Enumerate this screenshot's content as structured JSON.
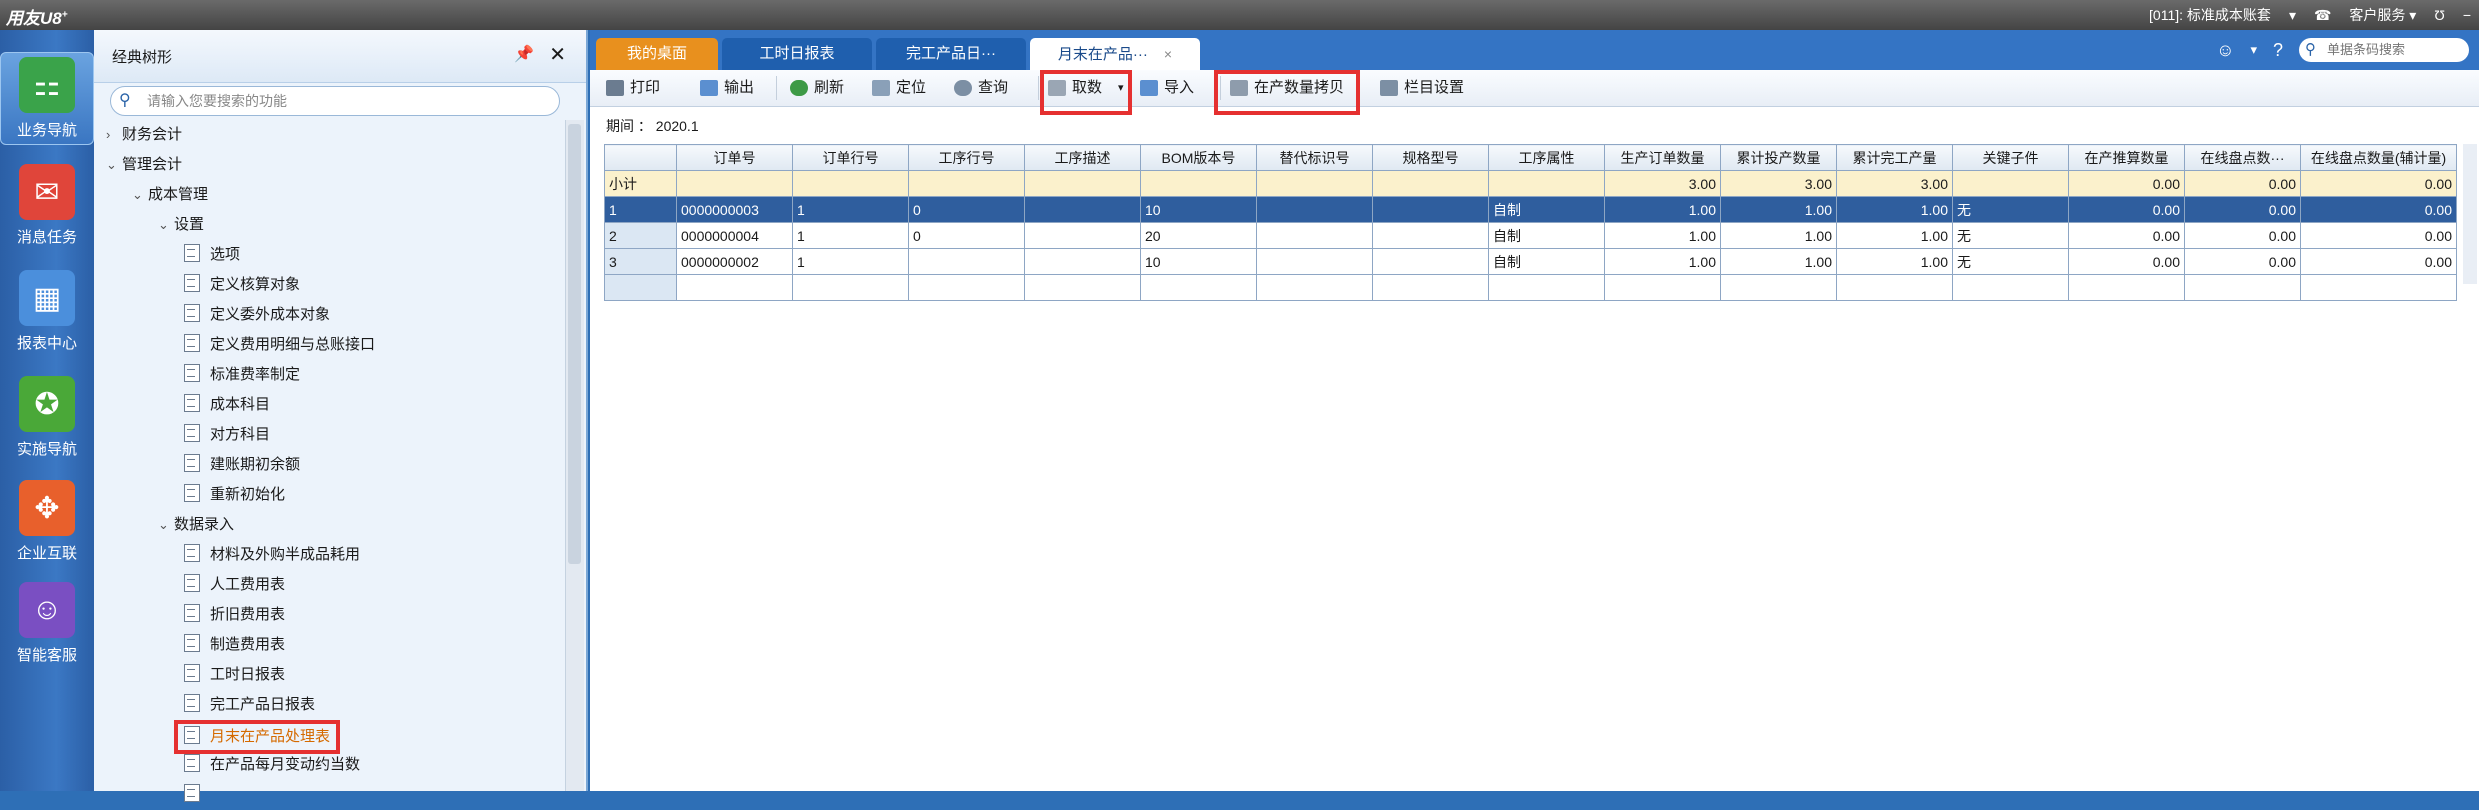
{
  "titlebar": {
    "logo": "用友U8",
    "logo_sup": "+",
    "account": "[011]: 标准成本账套",
    "customer_service": "客户服务",
    "icons": [
      "dropdown-icon",
      "headset-icon",
      "dropdown-icon",
      "u-icon",
      "minus-icon"
    ]
  },
  "leftnav": {
    "items": [
      {
        "label": "业务导航",
        "icon": "business-nav-icon",
        "color": "#3aa34a",
        "active": true
      },
      {
        "label": "消息任务",
        "icon": "message-task-icon",
        "color": "#e0453a"
      },
      {
        "label": "报表中心",
        "icon": "report-center-icon",
        "color": "#4b8fdc"
      },
      {
        "label": "实施导航",
        "icon": "compass-icon",
        "color": "#4aa838"
      },
      {
        "label": "企业互联",
        "icon": "enterprise-connect-icon",
        "color": "#e8602c"
      },
      {
        "label": "智能客服",
        "icon": "smart-service-icon",
        "color": "#7a4fc2"
      }
    ]
  },
  "tree": {
    "title": "经典树形",
    "search_placeholder": "请输入您要搜索的功能",
    "nodes": [
      {
        "label": "财务会计",
        "type": "collapsed"
      },
      {
        "label": "管理会计",
        "type": "expanded"
      },
      {
        "label": "成本管理",
        "type": "expanded"
      },
      {
        "label": "设置",
        "type": "expanded"
      },
      {
        "label": "选项",
        "type": "leaf"
      },
      {
        "label": "定义核算对象",
        "type": "leaf"
      },
      {
        "label": "定义委外成本对象",
        "type": "leaf"
      },
      {
        "label": "定义费用明细与总账接口",
        "type": "leaf"
      },
      {
        "label": "标准费率制定",
        "type": "leaf"
      },
      {
        "label": "成本科目",
        "type": "leaf"
      },
      {
        "label": "对方科目",
        "type": "leaf"
      },
      {
        "label": "建账期初余额",
        "type": "leaf"
      },
      {
        "label": "重新初始化",
        "type": "leaf"
      },
      {
        "label": "数据录入",
        "type": "expanded"
      },
      {
        "label": "材料及外购半成品耗用",
        "type": "leaf"
      },
      {
        "label": "人工费用表",
        "type": "leaf"
      },
      {
        "label": "折旧费用表",
        "type": "leaf"
      },
      {
        "label": "制造费用表",
        "type": "leaf"
      },
      {
        "label": "工时日报表",
        "type": "leaf"
      },
      {
        "label": "完工产品日报表",
        "type": "leaf"
      },
      {
        "label": "月末在产品处理表",
        "type": "leaf",
        "highlight": true
      },
      {
        "label": "在产品每月变动约当数",
        "type": "leaf"
      },
      {
        "label": "",
        "type": "leaf"
      }
    ]
  },
  "tabs": [
    {
      "label": "我的桌面",
      "kind": "home"
    },
    {
      "label": "工时日报表",
      "kind": "norm"
    },
    {
      "label": "完工产品日···",
      "kind": "norm"
    },
    {
      "label": "月末在产品···",
      "kind": "active",
      "close": "×"
    }
  ],
  "barsearch_placeholder": "单据条码搜索",
  "toolbar": {
    "print": "打印",
    "export": "输出",
    "refresh": "刷新",
    "locate": "定位",
    "query": "查询",
    "fetch": "取数",
    "import": "导入",
    "copy_wip_qty": "在产数量拷贝",
    "column_settings": "栏目设置"
  },
  "period_label": "期间 ： 2020.1",
  "grid": {
    "headers": [
      "",
      "订单号",
      "订单行号",
      "工序行号",
      "工序描述",
      "BOM版本号",
      "替代标识号",
      "规格型号",
      "工序属性",
      "生产订单数量",
      "累计投产数量",
      "累计完工产量",
      "关键子件",
      "在产推算数量",
      "在线盘点数···",
      "在线盘点数量(辅计量)"
    ],
    "subtotal": [
      "小计",
      "",
      "",
      "",
      "",
      "",
      "",
      "",
      "",
      "3.00",
      "3.00",
      "3.00",
      "",
      "0.00",
      "0.00",
      "0.00"
    ],
    "rows": [
      [
        "1",
        "0000000003",
        "1",
        "0",
        "",
        "10",
        "",
        "",
        "自制",
        "1.00",
        "1.00",
        "1.00",
        "无",
        "0.00",
        "0.00",
        "0.00"
      ],
      [
        "2",
        "0000000004",
        "1",
        "0",
        "",
        "20",
        "",
        "",
        "自制",
        "1.00",
        "1.00",
        "1.00",
        "无",
        "0.00",
        "0.00",
        "0.00"
      ],
      [
        "3",
        "0000000002",
        "1",
        "",
        "",
        "10",
        "",
        "",
        "自制",
        "1.00",
        "1.00",
        "1.00",
        "无",
        "0.00",
        "0.00",
        "0.00"
      ]
    ]
  },
  "colors": {
    "accent": "#3474c4",
    "home_tab": "#e8901e",
    "highlight": "#e53030",
    "selected_row": "#2f5e9e",
    "subtotal_row": "#fbf1cc"
  }
}
